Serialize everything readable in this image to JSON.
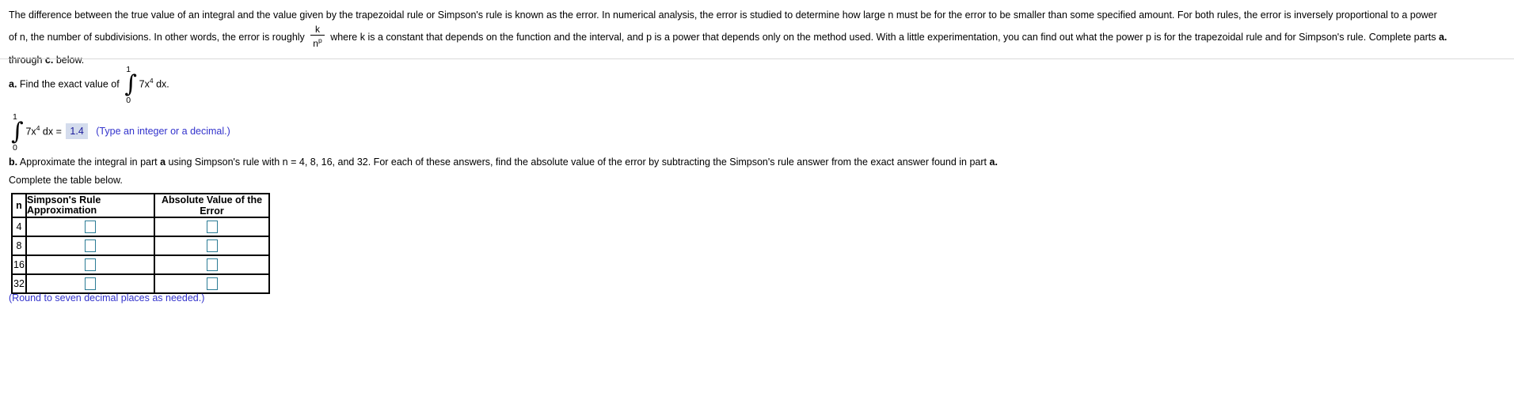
{
  "document": {
    "intro": {
      "line1_part1": "The difference between the true value of an integral and the value given by the trapezoidal rule or Simpson's rule is known as the error. In numerical analysis, the error is studied to determine how large n must be for the error to be smaller than some specified amount. For both rules, the error is inversely proportional to a power",
      "line2_part1": "of n, the number of subdivisions. In other words, the error is roughly",
      "fraction_numerator": "k",
      "fraction_denominator_base": "n",
      "fraction_denominator_exponent": "p",
      "line2_part2": "where k is a constant that depends on the function and the interval, and p is a power that depends only on the method used. With a little experimentation, you can find out what the power p is for the trapezoidal rule and for Simpson's rule. Complete parts",
      "line2_bold_a": "a.",
      "line3_part1": "through",
      "line3_bold_c": "c.",
      "line3_part2": "below."
    },
    "part_a": {
      "label": "a.",
      "text": "Find the exact value of",
      "integral": {
        "symbol": "∫",
        "upper_limit": "1",
        "lower_limit": "0",
        "integrand_coefficient": "7x",
        "integrand_exponent": "4",
        "differential": "dx."
      }
    },
    "answer_line": {
      "integral": {
        "symbol": "∫",
        "upper_limit": "1",
        "lower_limit": "0",
        "integrand_coefficient": "7x",
        "integrand_exponent": "4",
        "differential": "dx"
      },
      "equals": "=",
      "value": "1.4",
      "hint": "(Type an integer or a decimal.)"
    },
    "part_b": {
      "label": "b.",
      "text_part1": "Approximate the integral in part",
      "bold_a": "a",
      "text_part2": "using Simpson's rule with n = 4, 8, 16, and 32. For each of these answers, find the absolute value of the error by subtracting the Simpson's rule answer from the exact answer found in part",
      "bold_a2": "a."
    },
    "complete_table_text": "Complete the table below.",
    "table": {
      "headers": [
        "n",
        "Simpson's Rule Approximation",
        "Absolute Value of the Error"
      ],
      "header_col2_line1": "Simpson's Rule",
      "header_col2_line2": "Approximation",
      "rows": [
        {
          "n": "4",
          "approximation": "",
          "error": ""
        },
        {
          "n": "8",
          "approximation": "",
          "error": ""
        },
        {
          "n": "16",
          "approximation": "",
          "error": ""
        },
        {
          "n": "32",
          "approximation": "",
          "error": ""
        }
      ]
    },
    "round_note": "(Round to seven decimal places as needed.)",
    "colors": {
      "hint_text": "#3333cc",
      "answer_highlight_bg": "#d4dced",
      "answer_text": "#1a1a9c",
      "input_border": "#2b7c95",
      "divider": "#d9d9d9"
    }
  }
}
